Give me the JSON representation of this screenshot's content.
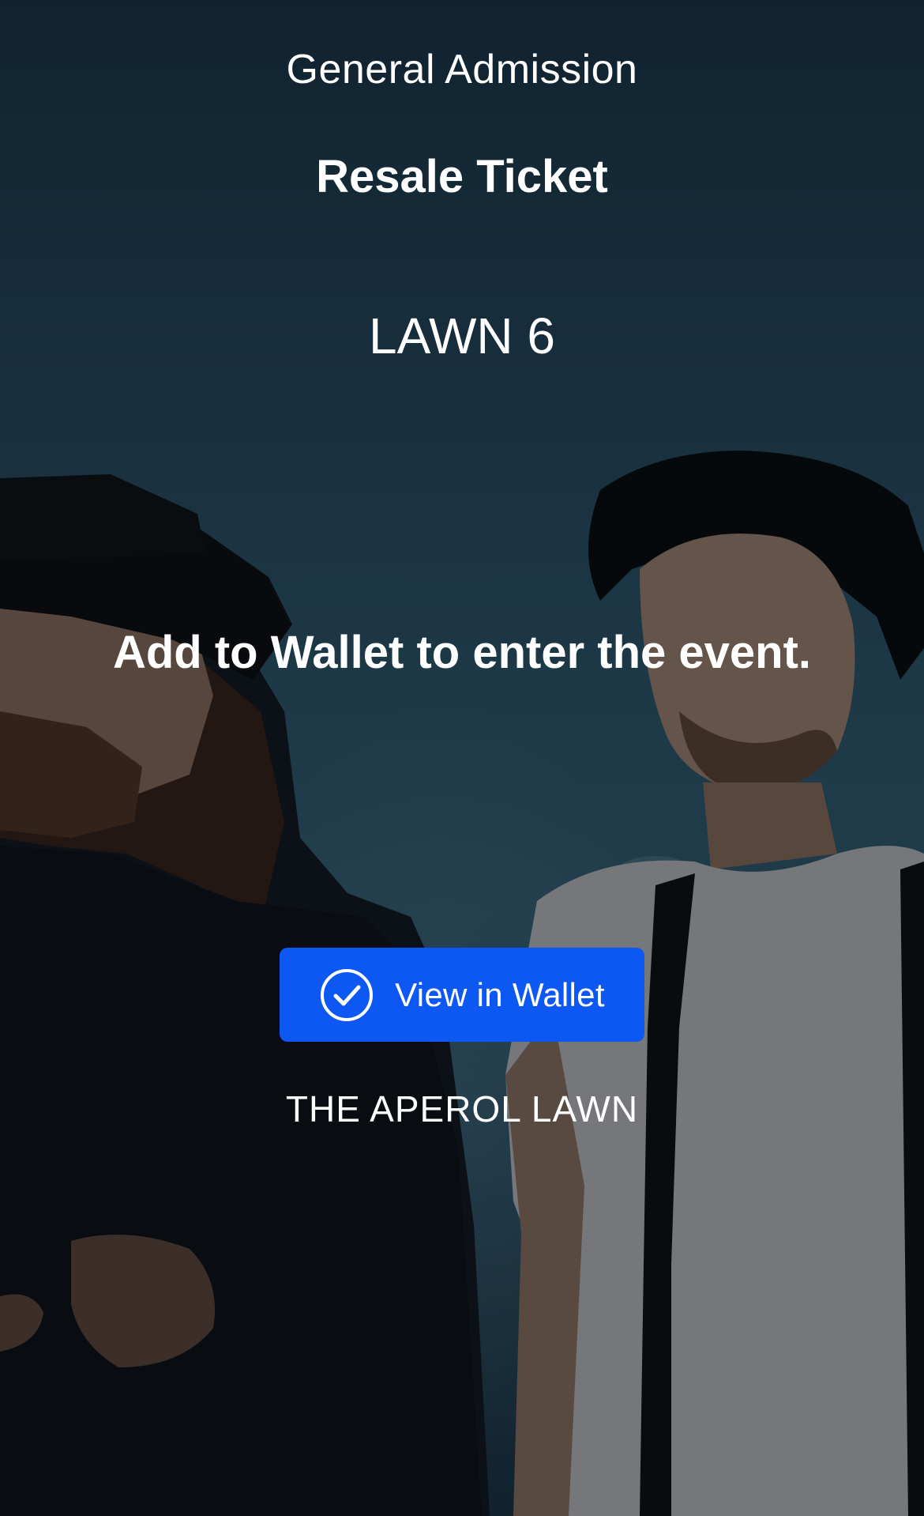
{
  "ticket": {
    "admission_type": "General Admission",
    "ticket_type": "Resale Ticket",
    "section": "LAWN 6",
    "instruction": "Add to Wallet to enter the event.",
    "wallet_button_label": "View in Wallet",
    "venue_area": "THE APEROL LAWN"
  },
  "icons": {
    "wallet_button_icon": "check-circle-icon"
  },
  "colors": {
    "button_background": "#0d57f2",
    "text": "#ffffff",
    "background": "#1e3a4c"
  }
}
